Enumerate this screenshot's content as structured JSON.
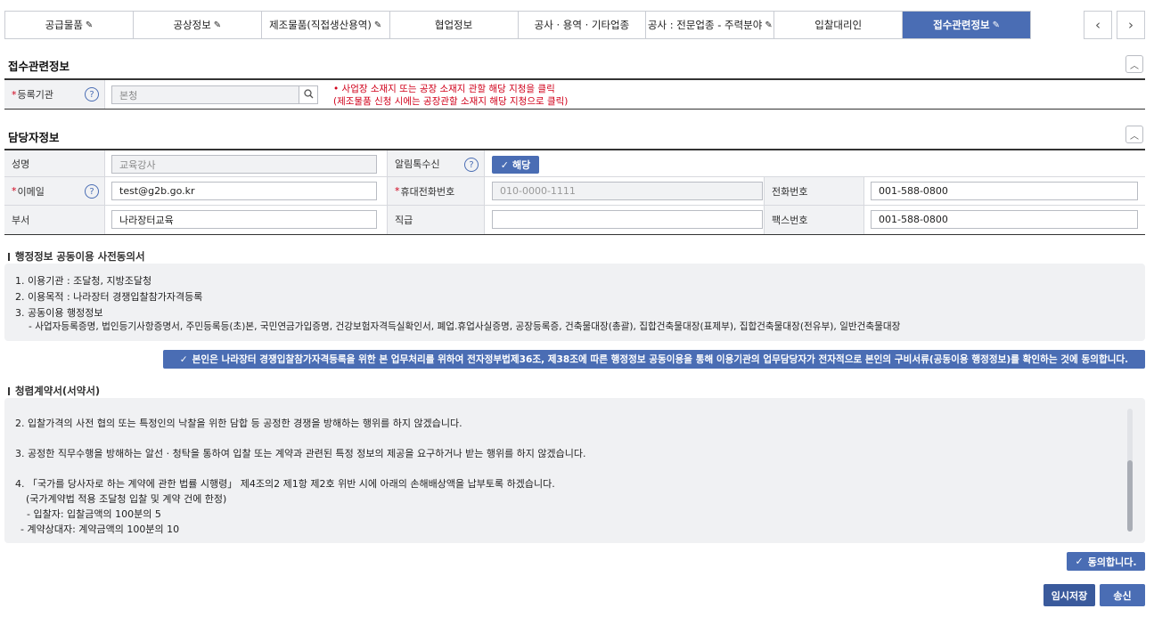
{
  "tabs": [
    {
      "label": "공급물품",
      "edit": true,
      "active": false
    },
    {
      "label": "공상정보",
      "edit": true,
      "active": false
    },
    {
      "label": "제조물품(직접생산용역)",
      "edit": true,
      "active": false
    },
    {
      "label": "협업정보",
      "edit": false,
      "active": false
    },
    {
      "label": "공사 · 용역 · 기타업종",
      "edit": false,
      "active": false
    },
    {
      "label": "공사 : 전문업종 - 주력분야",
      "edit": true,
      "active": false
    },
    {
      "label": "입찰대리인",
      "edit": false,
      "active": false
    },
    {
      "label": "접수관련정보",
      "edit": true,
      "active": true
    }
  ],
  "nav": {
    "prev": "‹",
    "next": "›"
  },
  "reception": {
    "title": "접수관련정보",
    "registry_label": "등록기관",
    "registry_value": "본청",
    "registry_note_1": "• 사업장 소재지 또는 공장 소재지 관할 해당 지청을 클릭",
    "registry_note_2": "(제조물품 신청 시에는 공장관할 소재지 해당 지청으로 클릭)"
  },
  "contact": {
    "title": "담당자정보",
    "name_label": "성명",
    "name_value": "교육강사",
    "notify_label": "알림톡수신",
    "notify_btn": "해당",
    "email_label": "이메일",
    "email_value": "test@g2b.go.kr",
    "mobile_label": "휴대전화번호",
    "mobile_placeholder": "010-0000-1111",
    "phone_label": "전화번호",
    "phone_value": "001-588-0800",
    "dept_label": "부서",
    "dept_value": "나라장터교육",
    "position_label": "직급",
    "position_value": "",
    "fax_label": "팩스번호",
    "fax_value": "001-588-0800"
  },
  "consent": {
    "title": "행정정보 공동이용 사전동의서",
    "lines": [
      "1. 이용기관 : 조달청, 지방조달청",
      "2. 이용목적 : 나라장터 경쟁입찰참가자격등록",
      "3. 공동이용 행정정보",
      "- 사업자등록증명, 법인등기사항증명서, 주민등록등(초)본, 국민연금가입증명, 건강보험자격득실확인서, 폐업.휴업사실증명, 공장등록증, 건축물대장(총괄), 집합건축물대장(표제부), 집합건축물대장(전유부), 일반건축물대장"
    ],
    "agree_btn": "본인은 나라장터 경쟁입찰참가자격등록을 위한 본 업무처리를 위하여 전자정부법제36조, 제38조에 따른 행정정보 공동이용을 통해 이용기관의 업무담당자가 전자적으로 본인의 구비서류(공동이용 행정정보)를 확인하는 것에 동의합니다."
  },
  "pledge": {
    "title": "청렴계약서(서약서)",
    "lines": [
      "2. 입찰가격의 사전 협의 또는 특정인의 낙찰을 위한 담합 등 공정한 경쟁을 방해하는 행위를 하지 않겠습니다.",
      "3. 공정한 직무수행을 방해하는 알선 · 청탁을 통하여 입찰 또는 계약과 관련된 특정 정보의 제공을 요구하거나 받는 행위를 하지 않겠습니다.",
      "4. 「국가를 당사자로 하는 계약에 관한 법률 시행령」 제4조의2 제1항 제2호 위반 시에 아래의 손해배상액을 납부토록 하겠습니다.",
      "(국가계약법 적용 조달청 입찰 및 계약 건에 한정)",
      "- 입찰자: 입찰금액의 100분의 5",
      "- 계약상대자: 계약금액의 100분의 10"
    ],
    "agree_btn": "동의합니다."
  },
  "actions": {
    "save": "임시저장",
    "send": "송신"
  },
  "colors": {
    "accent": "#4a6db4",
    "required": "#d0021b"
  }
}
